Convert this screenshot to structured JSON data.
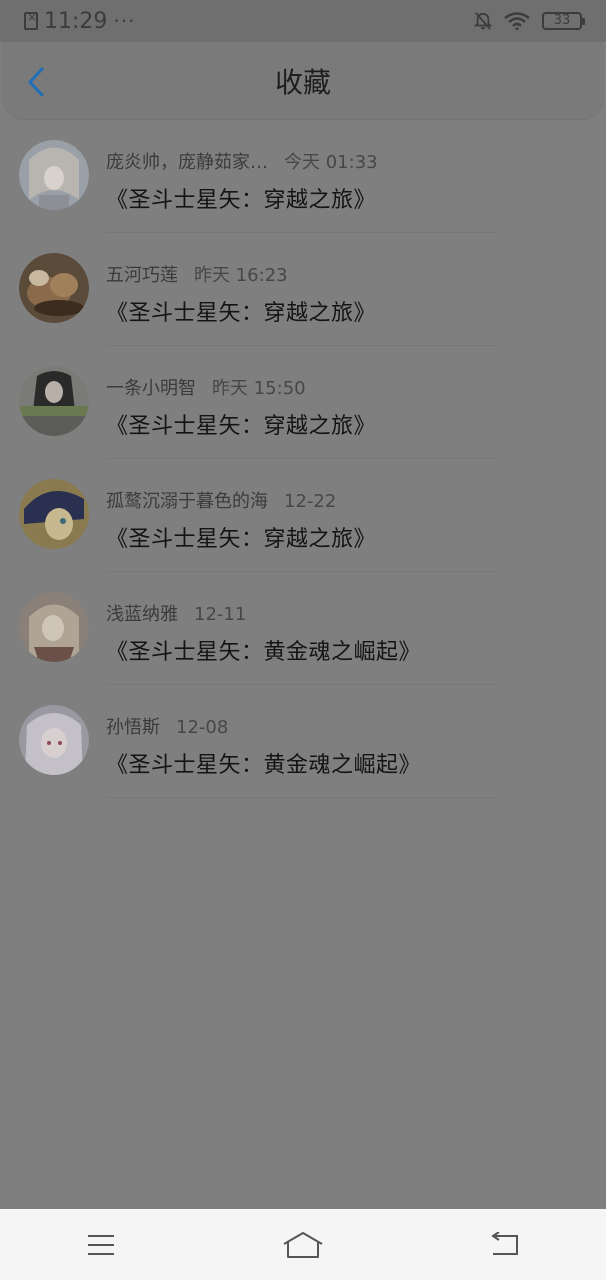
{
  "status_bar": {
    "time": "11:29",
    "dots": "···",
    "battery": "33"
  },
  "header": {
    "title": "收藏"
  },
  "items": [
    {
      "name": "庞炎帅，庞静茹家…",
      "time": "今天 01:33",
      "title": "《圣斗士星矢：穿越之旅》"
    },
    {
      "name": "五河巧莲",
      "time": "昨天 16:23",
      "title": "《圣斗士星矢：穿越之旅》"
    },
    {
      "name": "一条小明智",
      "time": "昨天 15:50",
      "title": "《圣斗士星矢：穿越之旅》"
    },
    {
      "name": "孤鹜沉溺于暮色的海",
      "time": "12-22",
      "title": "《圣斗士星矢：穿越之旅》"
    },
    {
      "name": "浅蓝纳雅",
      "time": "12-11",
      "title": "《圣斗士星矢：黄金魂之崛起》"
    },
    {
      "name": "孙悟斯",
      "time": "12-08",
      "title": "《圣斗士星矢：黄金魂之崛起》"
    }
  ],
  "colors": {
    "accent": "#1f6fb8",
    "overlay": "#7f7f7f",
    "nav_bg": "#f5f5f5"
  }
}
